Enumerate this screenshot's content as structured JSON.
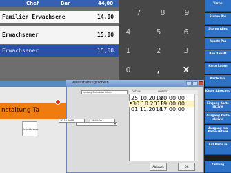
{
  "ticket": {
    "header": {
      "col1": "Chef",
      "col2": "Bar",
      "col3": "44,00"
    },
    "rows": [
      {
        "name": "Familien Erwachsene",
        "price": "14,00"
      },
      {
        "name": "Erwachsener",
        "price": "15,00"
      },
      {
        "name": "Erwachsener",
        "price": "15,00"
      }
    ]
  },
  "keypad": {
    "keys": [
      "7",
      "8",
      "9",
      "4",
      "5",
      "6",
      "1",
      "2",
      "3",
      "0",
      ",",
      "X"
    ]
  },
  "right_buttons": [
    "Vorne",
    "Storno Pos",
    "Storno Alles",
    "Rabatt Pos",
    "Bon Rabatt",
    "Karte Laden",
    "Karte Info",
    "Kasse Abrechnu",
    "Eingang Karte aktivie",
    "Ausgang Karte aktivie",
    "Ausgang ma Karte aktivie",
    "Auf Karte la",
    "Zahlung"
  ],
  "background_window": {
    "tab_text": "nstaltung Ta",
    "tab_box": "Erwachsener"
  },
  "dialog": {
    "title": "Veranstaltungsschein",
    "name_value": "Leisung Gebrüder Gilren",
    "date_value": "30.10.2018",
    "time_value": "19:00:00",
    "list": {
      "columns": [
        "DATUM",
        "UHRZEIT"
      ],
      "rows": [
        {
          "date": "25.10.2018",
          "time": "20:00:00"
        },
        {
          "date": "30.10.2018",
          "time": "19:00:00"
        },
        {
          "date": "01.11.2018",
          "time": "17:00:00"
        }
      ],
      "selected_index": 1
    },
    "buttons": {
      "cancel": "Abbruch",
      "ok": "OK"
    }
  },
  "colors": {
    "accent_blue": "#2e72c8",
    "orange": "#f07c10",
    "selected_row": "#2c50a8"
  }
}
